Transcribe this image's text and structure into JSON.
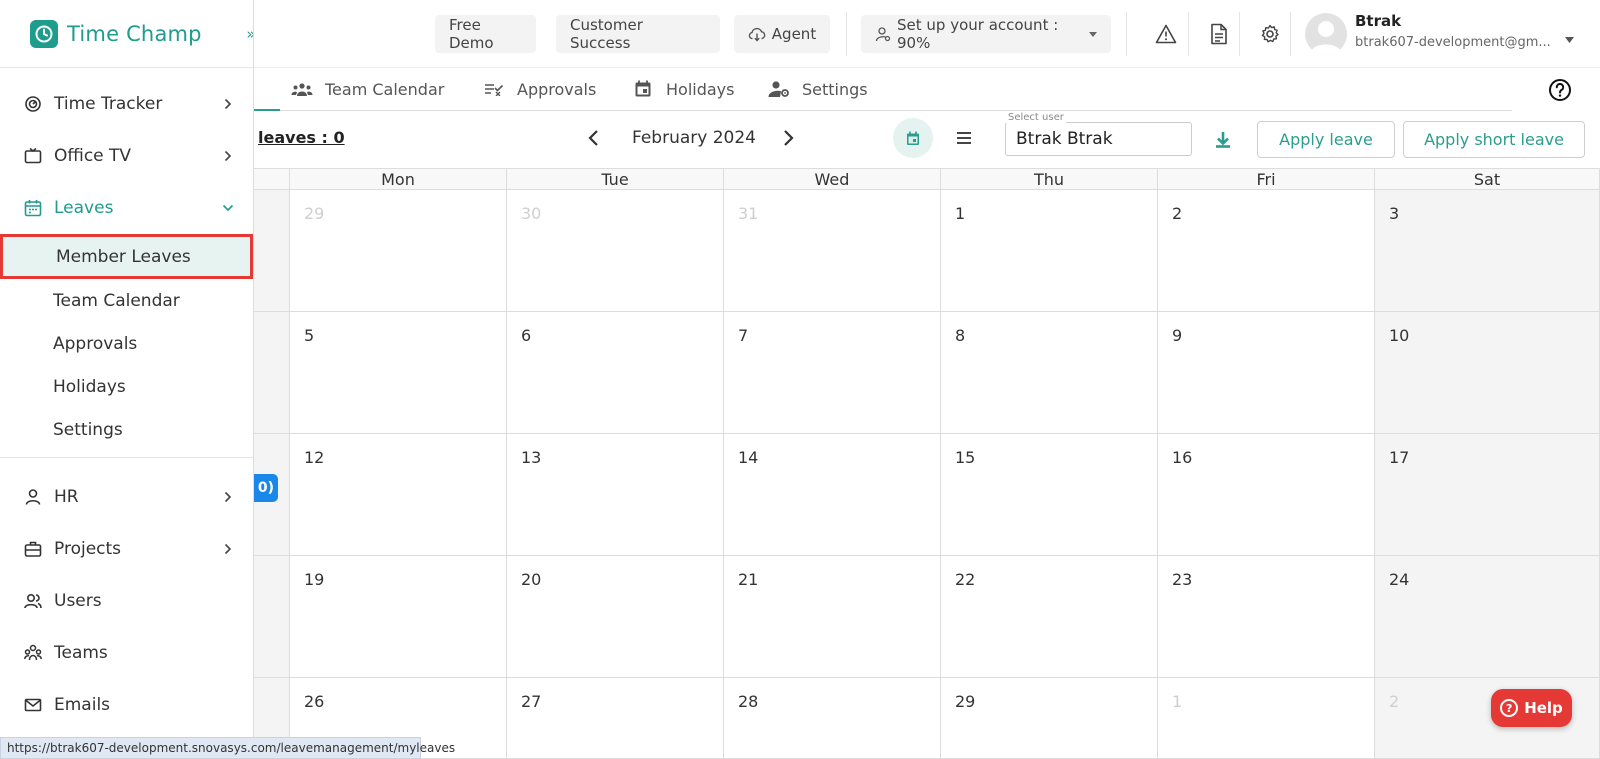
{
  "app": {
    "brand": "Time Champ"
  },
  "sidebar": {
    "items": [
      {
        "label": "Time Tracker",
        "icon": "timer-icon"
      },
      {
        "label": "Office TV",
        "icon": "tv-icon"
      },
      {
        "label": "Leaves",
        "icon": "calendar-icon"
      }
    ],
    "sub_items": [
      "Member Leaves",
      "Team Calendar",
      "Approvals",
      "Holidays",
      "Settings"
    ],
    "selected_sub": "Member Leaves",
    "items_after": [
      {
        "label": "HR",
        "icon": "person-icon"
      },
      {
        "label": "Projects",
        "icon": "briefcase-icon"
      },
      {
        "label": "Users",
        "icon": "users-icon"
      },
      {
        "label": "Teams",
        "icon": "teams-icon"
      },
      {
        "label": "Emails",
        "icon": "mail-icon"
      }
    ]
  },
  "topbar": {
    "free_demo": "Free Demo",
    "customer_success": "Customer Success",
    "agent": "Agent",
    "setup": "Set up your account : 90%",
    "user_name": "Btrak",
    "user_email": "btrak607-development@gm..."
  },
  "tabs": [
    "Team Calendar",
    "Approvals",
    "Holidays",
    "Settings"
  ],
  "toolbar": {
    "leaves_count": "leaves : 0",
    "month": "February 2024",
    "select_user_label": "Select user",
    "select_user_value": "Btrak Btrak",
    "apply_leave": "Apply leave",
    "apply_short_leave": "Apply short leave"
  },
  "calendar": {
    "day_headers": [
      "Mon",
      "Tue",
      "Wed",
      "Thu",
      "Fri",
      "Sat"
    ],
    "weeks": [
      [
        "29",
        "30",
        "31",
        "1",
        "2",
        "3"
      ],
      [
        "5",
        "6",
        "7",
        "8",
        "9",
        "10"
      ],
      [
        "12",
        "13",
        "14",
        "15",
        "16",
        "17"
      ],
      [
        "19",
        "20",
        "21",
        "22",
        "23",
        "24"
      ],
      [
        "26",
        "27",
        "28",
        "29",
        "1",
        "2"
      ]
    ],
    "other_month_flags": [
      [
        true,
        true,
        true,
        false,
        false,
        false
      ],
      [
        false,
        false,
        false,
        false,
        false,
        false
      ],
      [
        false,
        false,
        false,
        false,
        false,
        false
      ],
      [
        false,
        false,
        false,
        false,
        false,
        false
      ],
      [
        false,
        false,
        false,
        false,
        true,
        true
      ]
    ],
    "event_chip": "0)"
  },
  "help": {
    "label": "Help"
  },
  "status_url": "https://btrak607-development.snovasys.com/leavemanagement/myleaves",
  "colors": {
    "accent": "#1e9c8c",
    "highlight_border": "#e53935",
    "chip": "#1a88e8"
  }
}
